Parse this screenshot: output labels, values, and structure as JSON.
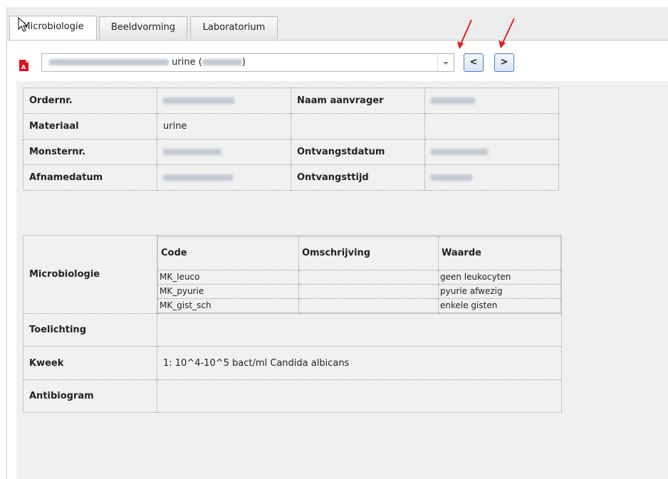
{
  "tabs": [
    "Microbiologie",
    "Beeldvorming",
    "Laboratorium"
  ],
  "selector": {
    "value": "urine (",
    "value_end": ")"
  },
  "nav": {
    "prev": "<",
    "next": ">"
  },
  "info": {
    "ordernr_label": "Ordernr.",
    "naam_aanvrager_label": "Naam aanvrager",
    "materiaal_label": "Materiaal",
    "materiaal_value": "urine",
    "monsternr_label": "Monsternr.",
    "ontvangstdatum_label": "Ontvangstdatum",
    "afnamedatum_label": "Afnamedatum",
    "ontvangsttijd_label": "Ontvangsttijd"
  },
  "micro": {
    "section_label": "Microbiologie",
    "headers": [
      "Code",
      "Omschrijving",
      "Waarde"
    ],
    "rows": [
      {
        "code": "MK_leuco",
        "omschrijving": "",
        "waarde": "geen leukocyten"
      },
      {
        "code": "MK_pyurie",
        "omschrijving": "",
        "waarde": "pyurie afwezig"
      },
      {
        "code": "MK_gist_sch",
        "omschrijving": "",
        "waarde": "enkele gisten"
      }
    ],
    "toelichting_label": "Toelichting",
    "kweek_label": "Kweek",
    "kweek_value": "1: 10^4-10^5 bact/ml Candida albicans",
    "antibiogram_label": "Antibiogram"
  },
  "colors": {
    "nav_border": "#4a7fc1",
    "annotation_arrow": "#e02020",
    "pdf_icon": "#d8141b"
  }
}
